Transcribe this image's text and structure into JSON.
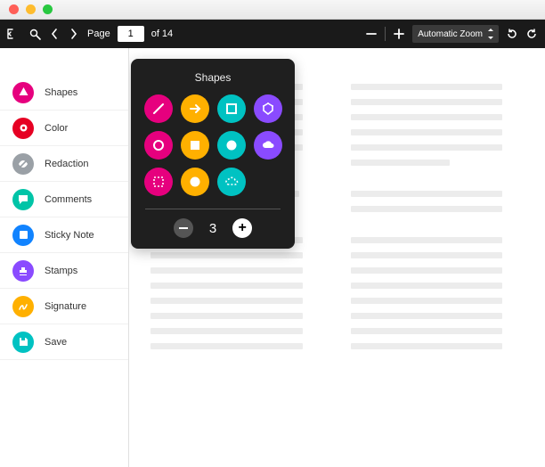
{
  "titlebar": {
    "dots": [
      "close",
      "minimize",
      "zoom"
    ]
  },
  "toolbar": {
    "page_label": "Page",
    "page_current": "1",
    "page_total_label": "of 14",
    "zoom_label": "Automatic Zoom"
  },
  "sidebar": {
    "items": [
      {
        "label": "Shapes",
        "color": "#e6007e",
        "icon": "shapes-icon"
      },
      {
        "label": "Color",
        "color": "#e60023",
        "icon": "color-icon"
      },
      {
        "label": "Redaction",
        "color": "#9aa0a6",
        "icon": "redaction-icon"
      },
      {
        "label": "Comments",
        "color": "#00c4a7",
        "icon": "comments-icon"
      },
      {
        "label": "Sticky Note",
        "color": "#1183ff",
        "icon": "sticky-note-icon"
      },
      {
        "label": "Stamps",
        "color": "#8a4bff",
        "icon": "stamps-icon"
      },
      {
        "label": "Signature",
        "color": "#ffb000",
        "icon": "signature-icon"
      },
      {
        "label": "Save",
        "color": "#00c2c2",
        "icon": "save-icon"
      }
    ]
  },
  "popover": {
    "title": "Shapes",
    "shapes": [
      {
        "name": "line-shape",
        "color": "#e6007e"
      },
      {
        "name": "arrow-shape",
        "color": "#ffb000"
      },
      {
        "name": "square-outline-shape",
        "color": "#00c2c2"
      },
      {
        "name": "polygon-shape",
        "color": "#8a4bff"
      },
      {
        "name": "circle-outline-shape",
        "color": "#e6007e"
      },
      {
        "name": "square-filled-shape",
        "color": "#ffb000"
      },
      {
        "name": "circle-filled-shape",
        "color": "#00c2c2"
      },
      {
        "name": "cloud-filled-shape",
        "color": "#8a4bff"
      },
      {
        "name": "square-dashed-shape",
        "color": "#e6007e"
      },
      {
        "name": "circle-blank-shape",
        "color": "#ffb000"
      },
      {
        "name": "cloud-outline-shape",
        "color": "#00c2c2"
      }
    ],
    "stepper_value": "3"
  }
}
